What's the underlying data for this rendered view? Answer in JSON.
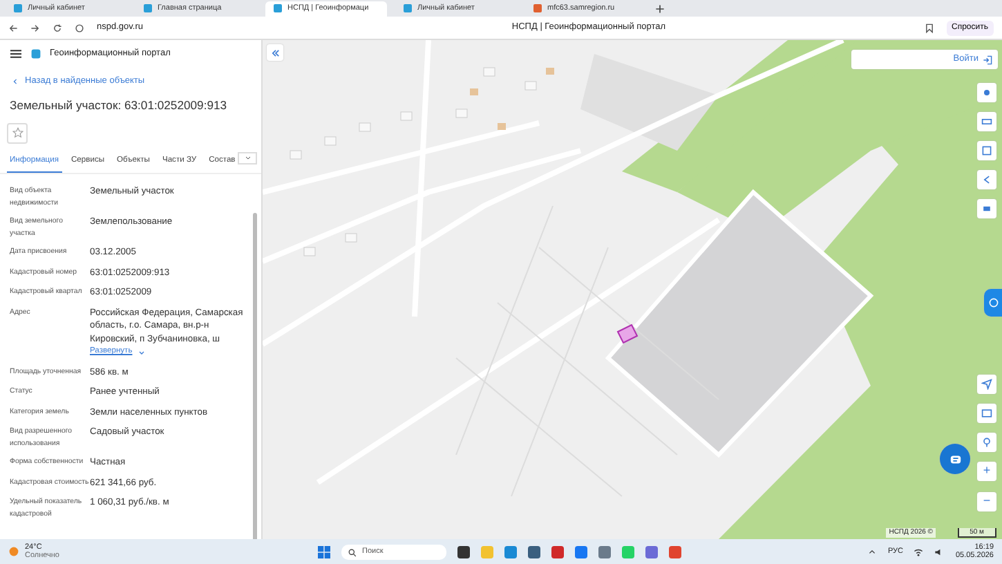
{
  "browser": {
    "tabs": [
      {
        "title": "Личный кабинет",
        "selected": false
      },
      {
        "title": "Главная страница",
        "selected": false
      },
      {
        "title": "НСПД | Геоинформаци",
        "selected": true
      },
      {
        "title": "Личный кабинет",
        "selected": false
      },
      {
        "title": "mfc63.samregion.ru",
        "selected": false
      }
    ],
    "url": "nspd.gov.ru",
    "page_title": "НСПД | Геоинформационный портал",
    "ask_button": "Спросить"
  },
  "sidebar": {
    "portal_title": "Геоинформационный портал",
    "back_link": "Назад в найденные объекты",
    "title": "Земельный участок: 63:01:0252009:913",
    "favorite": false,
    "tabs": [
      {
        "label": "Информация",
        "selected": true
      },
      {
        "label": "Сервисы",
        "selected": false
      },
      {
        "label": "Объекты",
        "selected": false
      },
      {
        "label": "Части ЗУ",
        "selected": false
      },
      {
        "label": "Состав",
        "selected": false
      }
    ],
    "fields": [
      {
        "label": "Вид объекта недвижимости",
        "value": "Земельный участок"
      },
      {
        "label": "Вид земельного участка",
        "value": "Землепользование"
      },
      {
        "label": "Дата присвоения",
        "value": "03.12.2005"
      },
      {
        "label": "Кадастровый номер",
        "value": "63:01:0252009:913"
      },
      {
        "label": "Кадастровый квартал",
        "value": "63:01:0252009"
      },
      {
        "label": "Адрес",
        "value": "Российская Федерация, Самарская область, г.о. Самара, вн.р-н Кировский, п Зубчаниновка, ш",
        "expand_link": "Развернуть"
      },
      {
        "label": "Площадь уточненная",
        "value": "586 кв. м"
      },
      {
        "label": "Статус",
        "value": "Ранее учтенный"
      },
      {
        "label": "Категория земель",
        "value": "Земли населенных пунктов"
      },
      {
        "label": "Вид разрешенного использования",
        "value": "Садовый участок"
      },
      {
        "label": "Форма собственности",
        "value": "Частная"
      },
      {
        "label": "Кадастровая стоимость",
        "value": "621 341,66 руб."
      },
      {
        "label": "Удельный показатель кадастровой",
        "value": "1 060,31 руб./кв. м"
      }
    ]
  },
  "map": {
    "login_button": "Войти",
    "zoom_in": "+",
    "zoom_out": "−",
    "copyright": "НСПД 2026 ©",
    "scale": "50 м"
  },
  "taskbar": {
    "temperature": "24°C",
    "weather": "Солнечно",
    "search_placeholder": "Поиск",
    "language": "РУС",
    "time": "16:19",
    "date": "05.05.2026"
  }
}
